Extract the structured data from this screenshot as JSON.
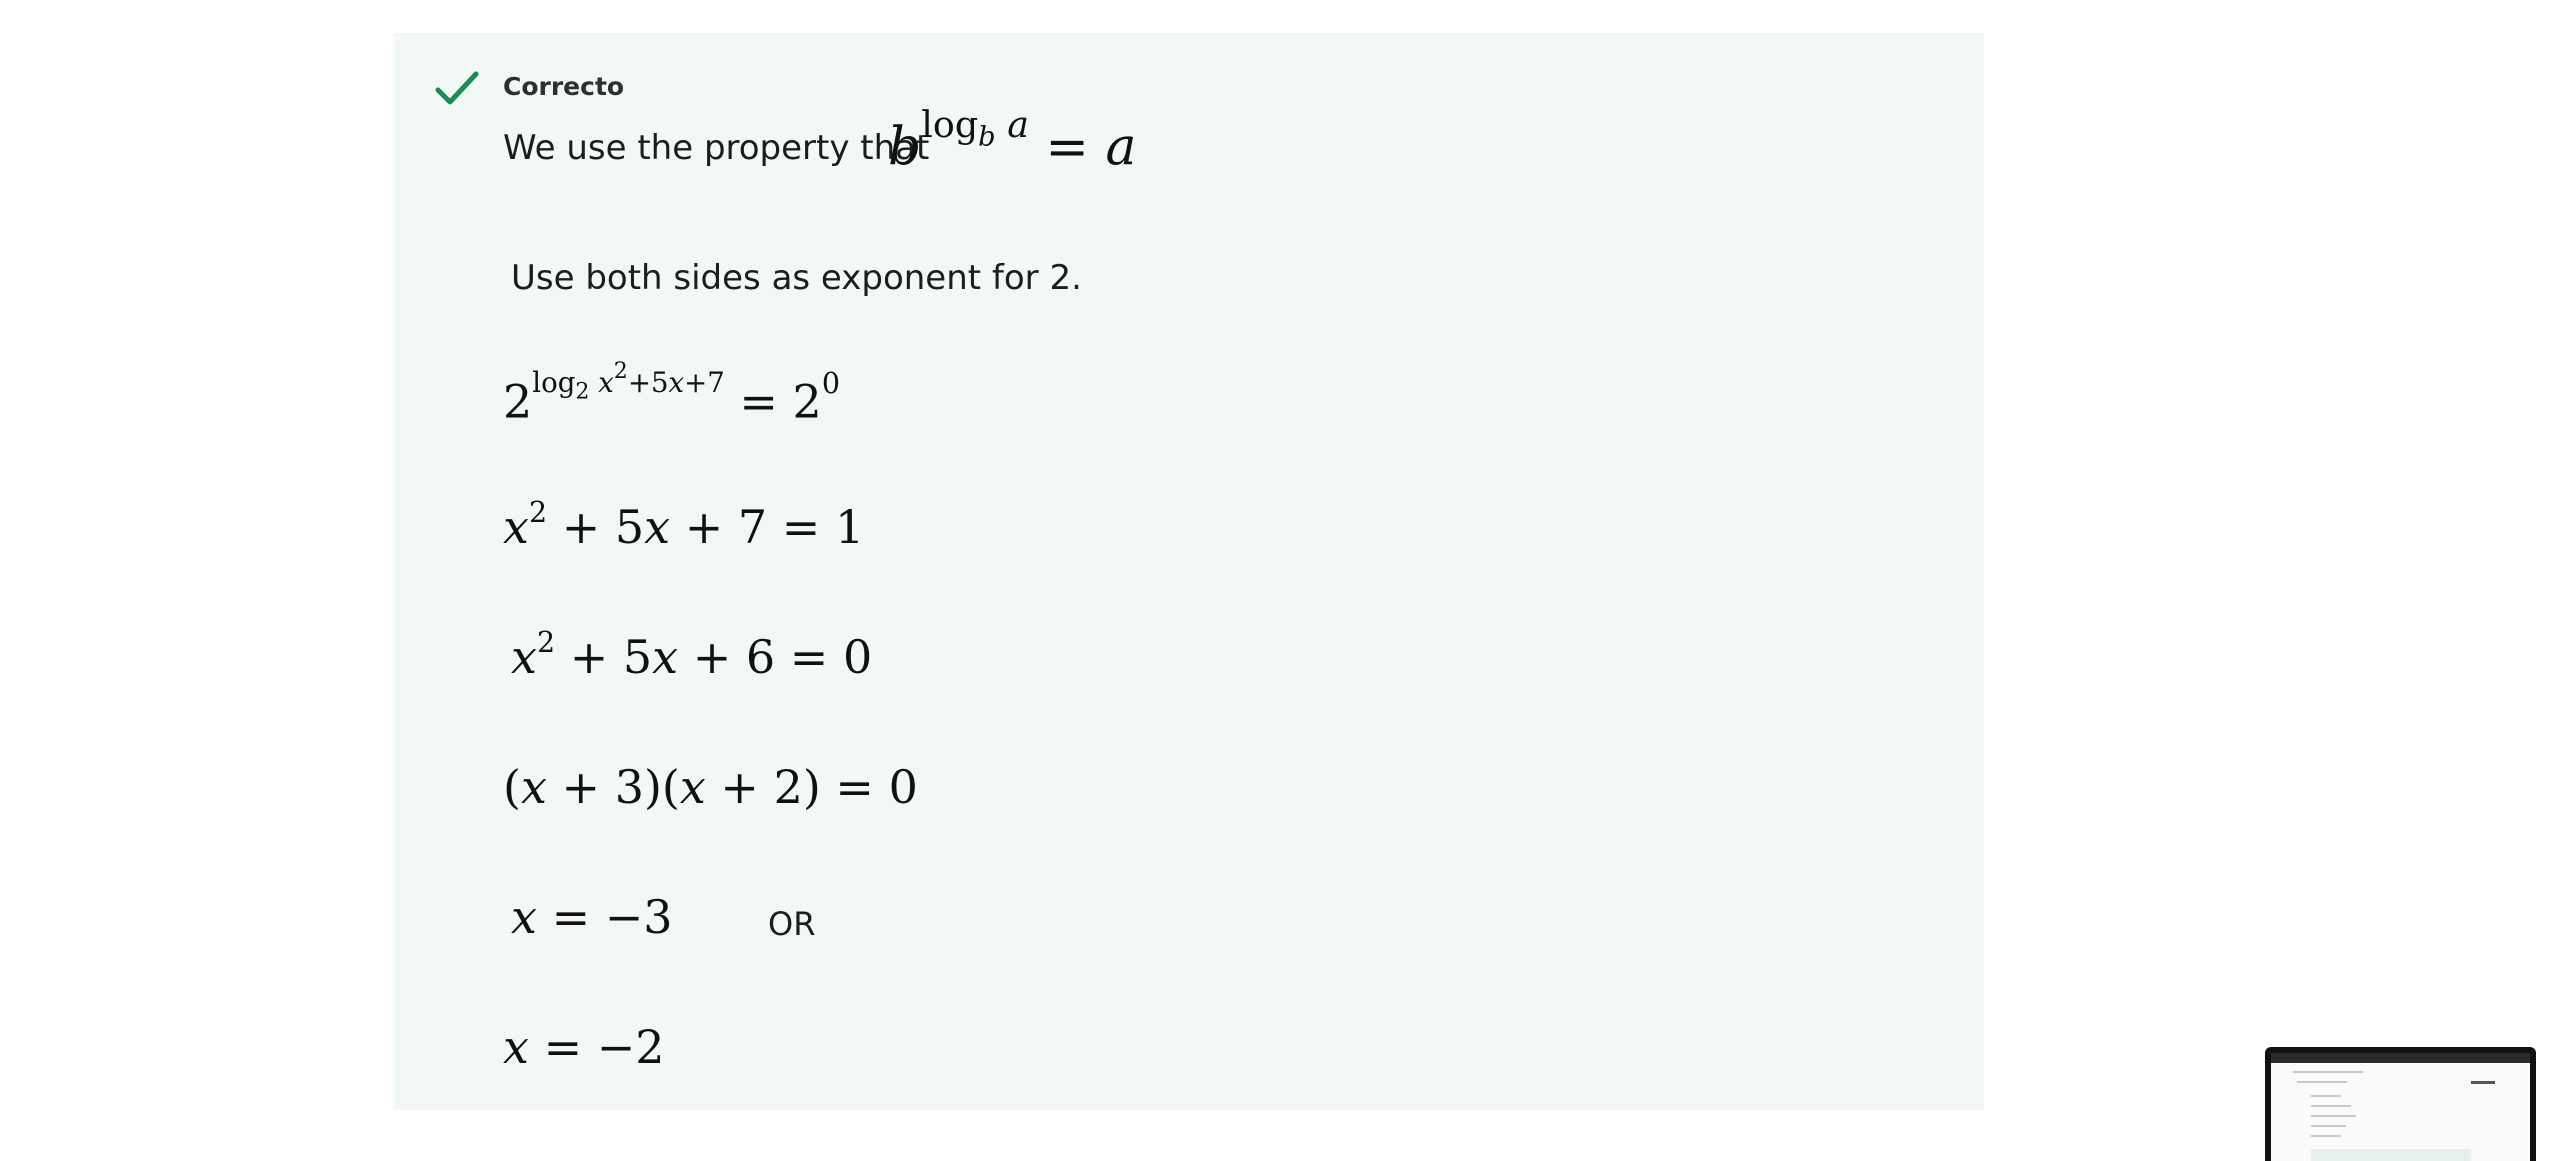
{
  "feedback": {
    "status": "Correcto",
    "intro_text": "We use the property that",
    "step1_text": "Use both sides as exponent for 2.",
    "or_text": "OR"
  },
  "math": {
    "property": "b^{log_b a} = a",
    "line1": "2^{log_2 x^2+5x+7} = 2^0",
    "line2": "x^2 + 5x + 7 = 1",
    "line3": "x^2 + 5x + 6 = 0",
    "line4": "(x + 3)(x + 2) = 0",
    "line5": "x = −3",
    "line6": "x = −2"
  },
  "icons": {
    "status_icon": "checkmark-icon"
  },
  "colors": {
    "panel_bg": "#f2f8f6",
    "success": "#1e8a55"
  }
}
